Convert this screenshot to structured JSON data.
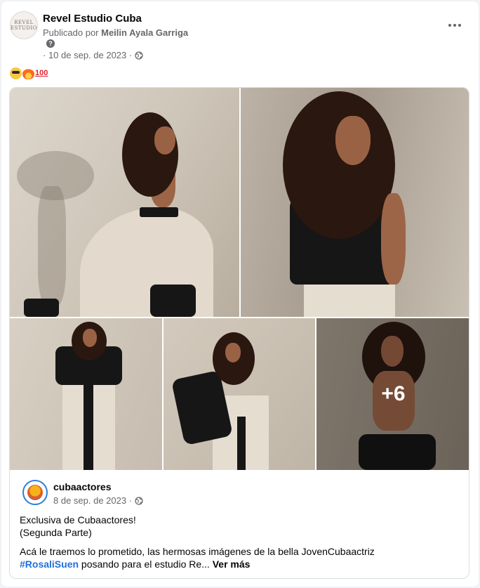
{
  "post": {
    "page_name": "Revel Estudio Cuba",
    "avatar_text": "REVEL\nESTUDIO",
    "published_prefix": "Publicado por",
    "published_by": "Meilin Ayala Garriga",
    "help_icon": "?",
    "date": "· 10 de sep. de 2023 ·",
    "emojis": [
      "smiling-face-with-sunglasses",
      "fire",
      "hundred-points"
    ],
    "more_icon": "more-horizontal-icon"
  },
  "gallery": {
    "extra_count": "+6"
  },
  "shared_post": {
    "author": "cubaactores",
    "date": "8 de sep. de 2023 ·",
    "line1": "Exclusiva de Cubaactores!",
    "line2": "(Segunda Parte)",
    "body_prefix": "Acá le traemos lo prometido, las hermosas imágenes de la bella JovenCubaactriz",
    "hashtag": "#RosaliSuen",
    "body_suffix": " posando para el estudio Re...",
    "see_more": "Ver más"
  },
  "colors": {
    "link": "#216fdb",
    "secondary_text": "#65676b",
    "avatar_ring": "#2d7fd6"
  }
}
